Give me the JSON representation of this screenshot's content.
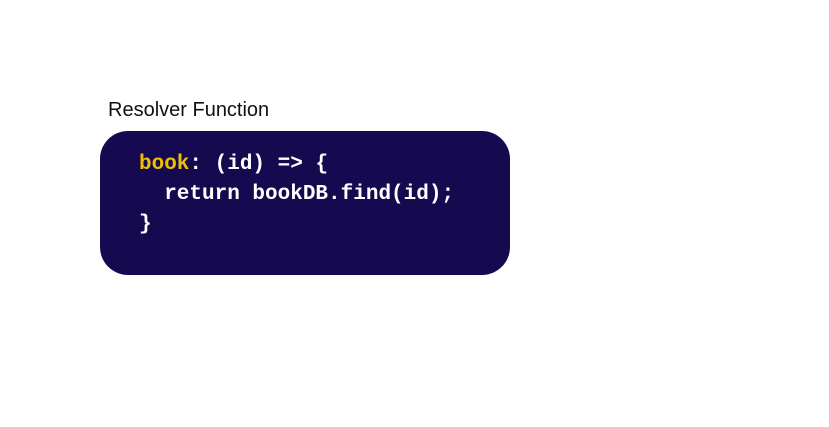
{
  "label": "Resolver Function",
  "code": {
    "key": "book",
    "line1_rest": ": (id) => {",
    "line2": "  return bookDB.find(id);",
    "line3": "}"
  },
  "colors": {
    "background": "#150a4f",
    "key": "#f0c000",
    "text": "#ffffff"
  }
}
